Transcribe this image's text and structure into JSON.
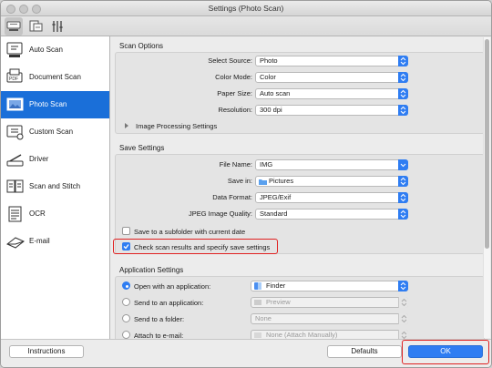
{
  "window": {
    "title": "Settings (Photo Scan)"
  },
  "toolbar": {
    "buttons": [
      "scanner-settings-icon",
      "general-settings-icon",
      "tools-icon"
    ]
  },
  "sidebar": {
    "items": [
      {
        "label": "Auto Scan",
        "icon": "auto-scan-icon"
      },
      {
        "label": "Document Scan",
        "icon": "document-scan-icon"
      },
      {
        "label": "Photo Scan",
        "icon": "photo-scan-icon"
      },
      {
        "label": "Custom Scan",
        "icon": "custom-scan-icon"
      },
      {
        "label": "Driver",
        "icon": "driver-icon"
      },
      {
        "label": "Scan and Stitch",
        "icon": "scan-and-stitch-icon"
      },
      {
        "label": "OCR",
        "icon": "ocr-icon"
      },
      {
        "label": "E-mail",
        "icon": "email-icon"
      }
    ],
    "selected": "Photo Scan"
  },
  "scan_options": {
    "title": "Scan Options",
    "rows": [
      {
        "label": "Select Source:",
        "value": "Photo"
      },
      {
        "label": "Color Mode:",
        "value": "Color"
      },
      {
        "label": "Paper Size:",
        "value": "Auto scan"
      },
      {
        "label": "Resolution:",
        "value": "300 dpi"
      }
    ],
    "image_processing": "Image Processing Settings"
  },
  "save_settings": {
    "title": "Save Settings",
    "rows": [
      {
        "label": "File Name:",
        "value": "IMG"
      },
      {
        "label": "Save in:",
        "value": "Pictures"
      },
      {
        "label": "Data Format:",
        "value": "JPEG/Exif"
      },
      {
        "label": "JPEG Image Quality:",
        "value": "Standard"
      }
    ],
    "subfolder_label": "Save to a subfolder with current date",
    "subfolder_checked": false,
    "check_results_label": "Check scan results and specify save settings",
    "check_results_checked": true
  },
  "application_settings": {
    "title": "Application Settings",
    "rows": [
      {
        "label": "Open with an application:",
        "value": "Finder",
        "selected": true
      },
      {
        "label": "Send to an application:",
        "value": "Preview",
        "selected": false
      },
      {
        "label": "Send to a folder:",
        "value": "None",
        "selected": false
      },
      {
        "label": "Attach to e-mail:",
        "value": "None (Attach Manually)",
        "selected": false
      }
    ]
  },
  "footer": {
    "instructions": "Instructions",
    "defaults": "Defaults",
    "ok": "OK"
  },
  "colors": {
    "accent": "#2f7df2",
    "highlight": "#e02020",
    "sidebar_selected": "#1a6fd9"
  }
}
